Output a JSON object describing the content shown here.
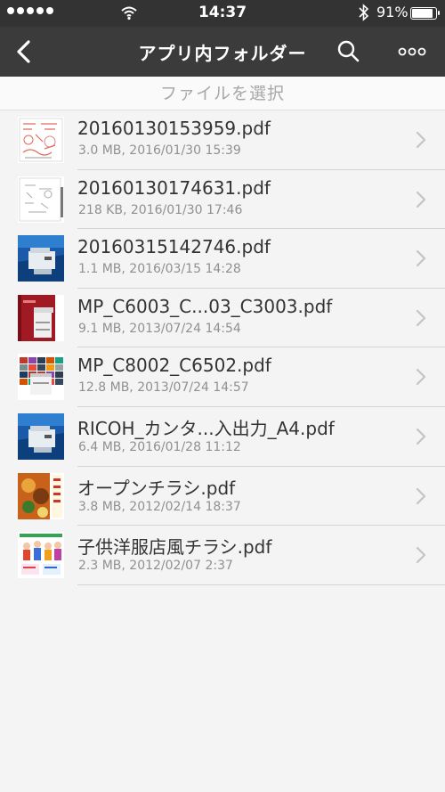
{
  "status": {
    "time": "14:37",
    "battery_text": "91%",
    "battery_level": 0.91
  },
  "nav": {
    "title": "アプリ内フォルダー",
    "back_icon": "chevron-left-icon",
    "search_icon": "search-icon",
    "more_icon": "more-icon"
  },
  "subheader": "ファイルを選択",
  "files": [
    {
      "name": "20160130153959.pdf",
      "meta": "3.0 MB, 2016/01/30 15:39",
      "thumb": "sketch-red"
    },
    {
      "name": "20160130174631.pdf",
      "meta": "218 KB, 2016/01/30 17:46",
      "thumb": "sketch-gray"
    },
    {
      "name": "20160315142746.pdf",
      "meta": "1.1 MB, 2016/03/15 14:28",
      "thumb": "blue-printer"
    },
    {
      "name": "MP_C6003_C...03_C3003.pdf",
      "meta": "9.1 MB, 2013/07/24 14:54",
      "thumb": "red-copier"
    },
    {
      "name": "MP_C8002_C6502.pdf",
      "meta": "12.8 MB, 2013/07/24 14:57",
      "thumb": "mosaic"
    },
    {
      "name": "RICOH_カンタ...入出力_A4.pdf",
      "meta": "6.4 MB, 2016/01/28 11:12",
      "thumb": "blue-printer"
    },
    {
      "name": "オープンチラシ.pdf",
      "meta": "3.8 MB, 2012/02/14 18:37",
      "thumb": "food-flyer"
    },
    {
      "name": "子供洋服店風チラシ.pdf",
      "meta": "2.3 MB, 2012/02/07 2:37",
      "thumb": "kids-flyer"
    }
  ],
  "colors": {
    "status_bar": "#333333",
    "nav_bar": "#3b3b3b",
    "background": "#f4f4f4",
    "separator": "#d4d4d4",
    "meta_text": "#909090",
    "chevron": "#c4c4c4"
  }
}
